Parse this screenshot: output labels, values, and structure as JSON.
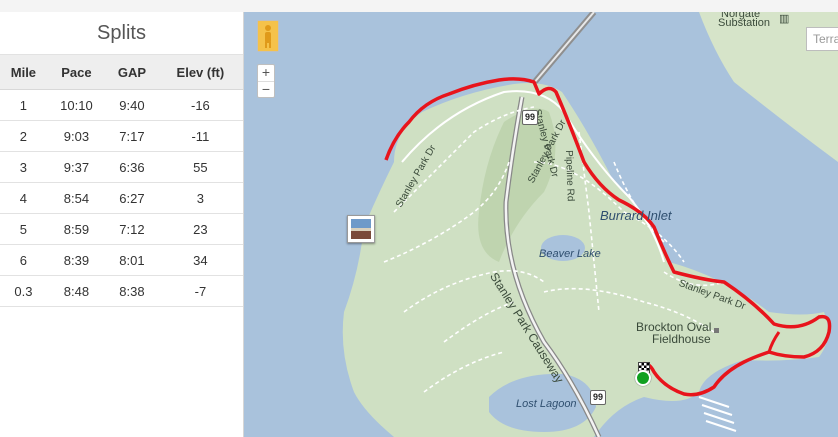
{
  "splits": {
    "title": "Splits",
    "columns": [
      "Mile",
      "Pace",
      "GAP",
      "Elev (ft)"
    ],
    "rows": [
      [
        "1",
        "10:10",
        "9:40",
        "-16"
      ],
      [
        "2",
        "9:03",
        "7:17",
        "-11"
      ],
      [
        "3",
        "9:37",
        "6:36",
        "55"
      ],
      [
        "4",
        "8:54",
        "6:27",
        "3"
      ],
      [
        "5",
        "8:59",
        "7:12",
        "23"
      ],
      [
        "6",
        "8:39",
        "8:01",
        "34"
      ],
      [
        "0.3",
        "8:48",
        "8:38",
        "-7"
      ]
    ]
  },
  "map": {
    "map_type_button": "Terra",
    "zoom_in": "+",
    "zoom_out": "−",
    "labels": {
      "norgate": "Norgate",
      "substation": "Substation",
      "burrard_inlet": "Burrard Inlet",
      "beaver_lake": "Beaver Lake",
      "stanley_park_causeway": "Stanley Park Causeway",
      "pipeline_rd": "Pipeline Rd",
      "stanley_park_dr_1": "Stanley Park Dr",
      "stanley_park_dr_2": "Stanley Park Dr",
      "stanley_park_dr_3": "Stanley Park Dr",
      "stanley_park_dr_4": "Stanley Park Dr",
      "brockton_oval": "Brockton Oval",
      "fieldhouse": "Fieldhouse",
      "lost_lagoon": "Lost Lagoon",
      "hwy_99_a": "99",
      "hwy_99_b": "99"
    },
    "colors": {
      "water": "#a9c2dc",
      "park": "#cfe0c3",
      "route": "#e8141c",
      "start_marker": "#10a020"
    }
  }
}
